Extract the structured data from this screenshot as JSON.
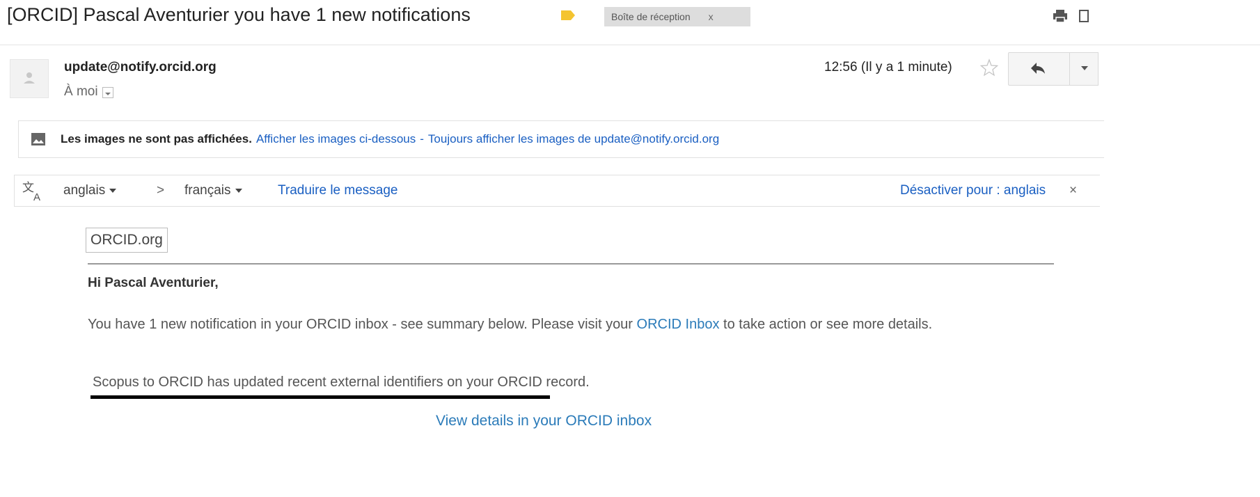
{
  "email": {
    "subject": "[ORCID] Pascal Aventurier you have 1 new notifications",
    "label_chip": "Boîte de réception",
    "label_chip_close": "x",
    "label_color": "#f4c430"
  },
  "header": {
    "sender": "update@notify.orcid.org",
    "recipient": "À moi",
    "timestamp": "12:56 (Il y a 1 minute)"
  },
  "images_banner": {
    "warning": "Les images ne sont pas affichées.",
    "show_below": "Afficher les images ci-dessous",
    "separator": "-",
    "always_show": "Toujours afficher les images de update@notify.orcid.org"
  },
  "translation": {
    "source_lang": "anglais",
    "arrow": ">",
    "target_lang": "français",
    "translate_link": "Traduire le message",
    "disable_link": "Désactiver pour : anglais",
    "close": "×"
  },
  "body": {
    "logo_text": "ORCID.org",
    "greeting": "Hi Pascal Aventurier,",
    "intro_part1": "You have 1 new notification in your ORCID inbox - see summary below. Please visit your ",
    "intro_link": "ORCID Inbox",
    "intro_part2": " to take action or see more details.",
    "notification": "Scopus to ORCID has updated recent external identifiers on your ORCID record.",
    "view_details": "View details in your ORCID inbox"
  },
  "colors": {
    "link_blue": "#1a5fc2",
    "orcid_link": "#2b7bb9"
  }
}
